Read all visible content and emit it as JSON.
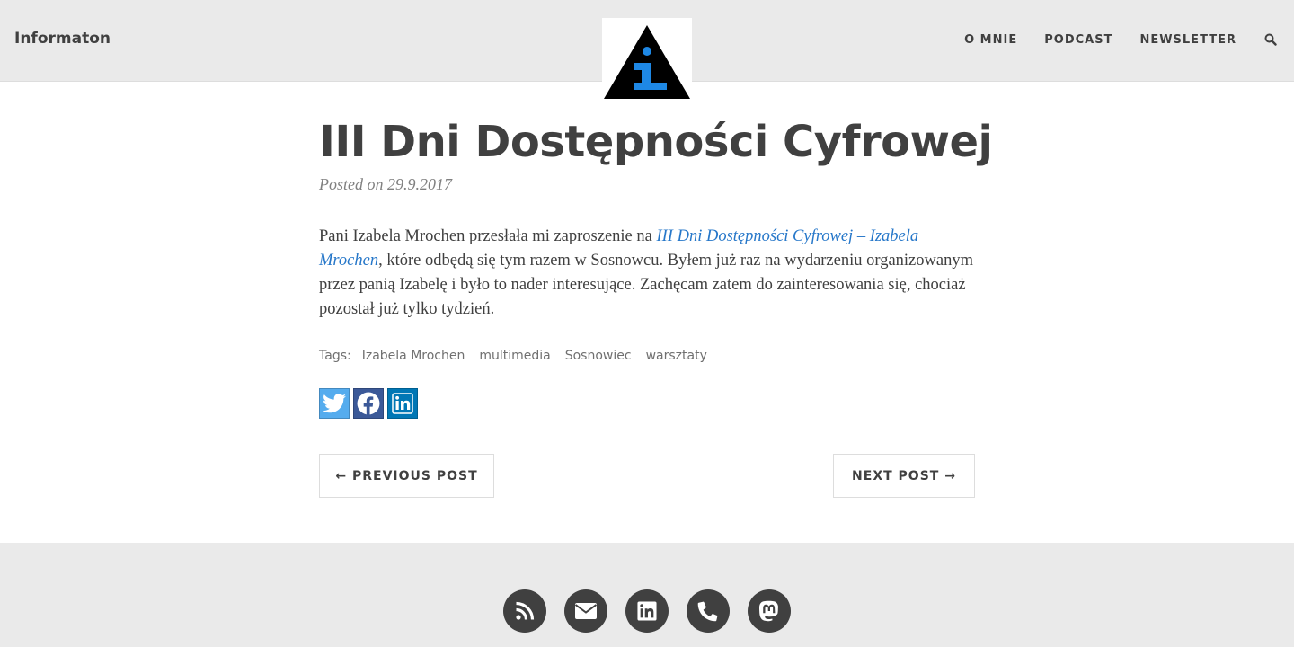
{
  "header": {
    "brand": "Informaton",
    "nav": [
      {
        "label": "O MNIE"
      },
      {
        "label": "PODCAST"
      },
      {
        "label": "NEWSLETTER"
      }
    ],
    "search_icon": "search-icon"
  },
  "post": {
    "title": "III Dni Dostępności Cyfrowej",
    "meta": "Posted on 29.9.2017",
    "body": {
      "before_link": "Pani Izabela Mrochen przesłała mi zaproszenie na ",
      "link_text": "III Dni Dostępności Cyfrowej – Izabela Mrochen",
      "after_link": ", które odbędą się tym razem w Sosnowcu. Byłem już raz na wydarzeniu organizowanym przez panią Izabelę i było to nader interesujące. Zachęcam zatem do zainteresowania się, chociaż pozostał już tylko tydzień."
    },
    "tags_label": "Tags:",
    "tags": [
      "Izabela Mrochen",
      "multimedia",
      "Sosnowiec",
      "warsztaty"
    ],
    "share": [
      "twitter-icon",
      "facebook-icon",
      "linkedin-icon"
    ]
  },
  "pager": {
    "prev": "← PREVIOUS POST",
    "next": "NEXT POST →"
  },
  "footer": {
    "icons": [
      "rss-icon",
      "email-icon",
      "linkedin-icon",
      "phone-icon",
      "mastodon-icon"
    ]
  },
  "colors": {
    "header_bg": "#EAEAEA",
    "text": "#404040",
    "link": "#2677C9",
    "logo_accent": "#1E88E5"
  }
}
